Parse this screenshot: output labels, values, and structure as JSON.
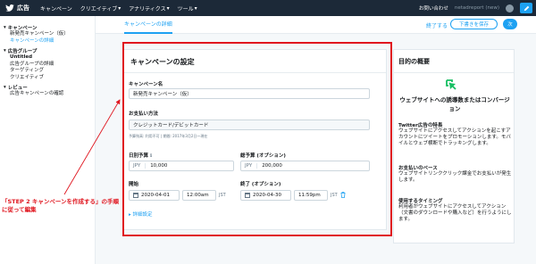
{
  "topbar": {
    "brand": "広告",
    "menu": [
      "キャンペーン",
      "クリエイティブ",
      "アナリティクス",
      "ツール"
    ],
    "help": "お問い合わせ",
    "account": "netadreport (new)"
  },
  "sidebar": {
    "sections": [
      {
        "title": "キャンペーン",
        "items": [
          "新発売キャンペーン（仮）",
          "キャンペーンの詳細"
        ]
      },
      {
        "title": "広告グループ",
        "items": [
          "Untitled",
          "広告グループの詳細",
          "ターゲティング",
          "クリエイティブ"
        ]
      },
      {
        "title": "レビュー",
        "items": [
          "広告キャンペーンの確認"
        ]
      }
    ]
  },
  "tabs": {
    "active": "キャンペーンの詳細",
    "exit": "終了する",
    "save": "下書きを保存",
    "next": "次"
  },
  "form": {
    "title": "キャンペーンの設定",
    "name_label": "キャンペーン名",
    "name_value": "新発売キャンペーン（仮）",
    "payment_label": "お支払い方法",
    "payment_value": "クレジットカード/デビットカード",
    "payment_hint": "予算残高: 利用不可 | 期間: 2017年3月2日〜現在",
    "daily_label": "日別予算",
    "daily_optional": "ℹ",
    "currency": "JPY",
    "daily_value": "10,000",
    "total_label": "総予算 (オプション)",
    "total_value": "200,000",
    "start_label": "開始",
    "start_date": "2020-04-01",
    "start_time": "12:00am",
    "end_label": "終了 (オプション)",
    "end_date": "2020-04-30",
    "end_time": "11:59pm",
    "tz": "JST",
    "advanced": "詳細設定"
  },
  "objective": {
    "title": "目的の概要",
    "name": "ウェブサイトへの誘導数またはコンバージョン",
    "feature_title": "Twitter広告の特長",
    "feature_text": "ウェブサイトにアクセスしてアクションを起こすアカウントにツイートをプロモーションします。モバイルとウェブ横断でトラッキングします。",
    "pay_title": "お支払いのベース",
    "pay_text": "ウェブサイトリンククリック課金でお支払いが発生します。",
    "timing_title": "使用するタイミング",
    "timing_text": "利用者がウェブサイトにアクセスしてアクション（文書のダウンロードや購入など）を行うようにします。"
  },
  "annotation": "「STEP 2 キャンペーンを作成する」の手順に従って編集",
  "colors": {
    "accent": "#1da1f2",
    "annotation": "#e0161f",
    "topbar": "#1c2938"
  }
}
